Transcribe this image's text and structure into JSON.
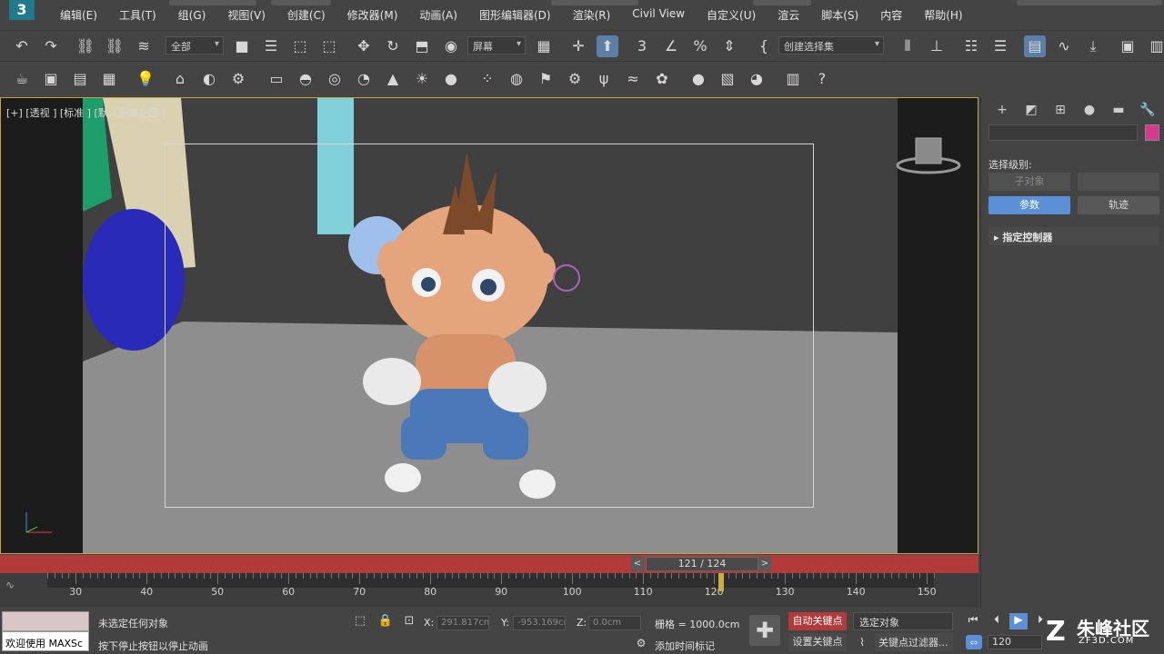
{
  "app": {
    "logo": "3"
  },
  "menu": [
    "编辑(E)",
    "工具(T)",
    "组(G)",
    "视图(V)",
    "创建(C)",
    "修改器(M)",
    "动画(A)",
    "图形编辑器(D)",
    "渲染(R)",
    "Civil View",
    "自定义(U)",
    "渲云",
    "脚本(S)",
    "内容",
    "帮助(H)"
  ],
  "toolbar1": {
    "filter_select": "全部",
    "ref_coord_select": "屏幕",
    "selection_set_select": "创建选择集"
  },
  "viewport": {
    "label": "[+] [透视 ] [标准 ] [默认明暗处理 ]"
  },
  "timeline": {
    "frame_display": "121 / 124",
    "prev": "<",
    "next": ">",
    "ticks": [
      "30",
      "40",
      "50",
      "60",
      "70",
      "80",
      "90",
      "100",
      "110",
      "120",
      "130",
      "140",
      "150"
    ],
    "current_frame": 121
  },
  "command_panel": {
    "selection_level_label": "选择级别:",
    "sub_object_button": "子对象",
    "params_button": "参数",
    "trajectory_button": "轨迹",
    "rollout_title": "指定控制器",
    "object_color": "#d63a8c"
  },
  "status": {
    "welcome": "欢迎使用 MAXSc",
    "prompt_line1": "未选定任何对象",
    "prompt_line2": "按下停止按钮以停止动画",
    "x_label": "X:",
    "x_value": "291.817cm",
    "y_label": "Y:",
    "y_value": "-953.169cm",
    "z_label": "Z:",
    "z_value": "0.0cm",
    "grid": "栅格 = 1000.0cm",
    "add_time_tag": "添加时间标记",
    "auto_key": "自动关键点",
    "set_key": "设置关键点",
    "selected_dd": "选定对象",
    "key_filters": "关键点过滤器...",
    "frame_field": "120"
  },
  "watermark": {
    "logo": "Z",
    "text": "朱峰社区",
    "url": "ZF3D.COM"
  }
}
